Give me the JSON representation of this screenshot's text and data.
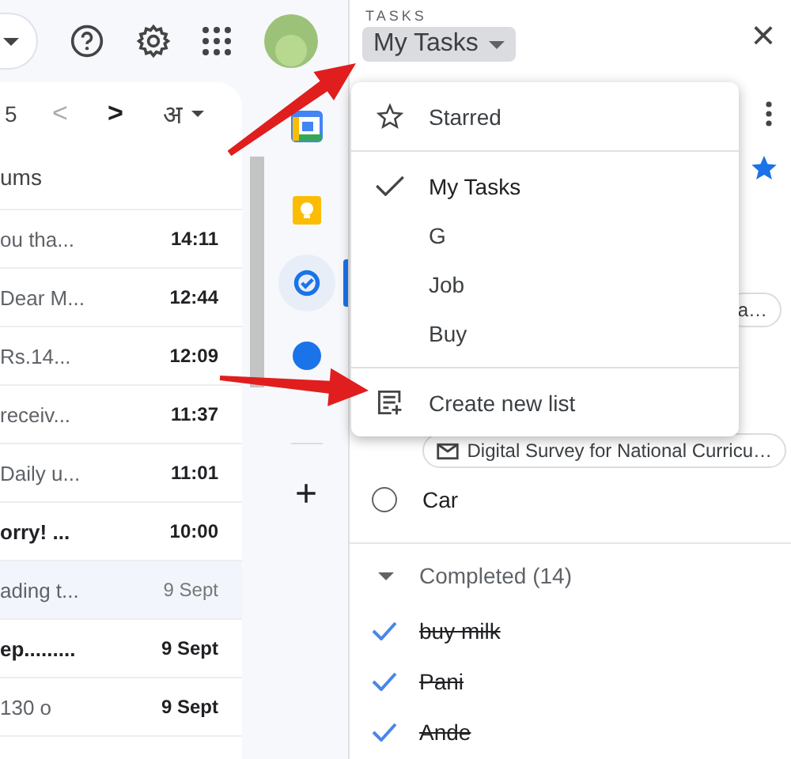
{
  "mail": {
    "pager": {
      "range": "5",
      "prev": "<",
      "next": ">",
      "language": "अ"
    },
    "heading": "ums",
    "rows": [
      {
        "text": "ou tha...",
        "time": "14:11",
        "kind": "snippet",
        "unread": true,
        "selected": false
      },
      {
        "text": "Dear M...",
        "time": "12:44",
        "kind": "snippet",
        "unread": true,
        "selected": false
      },
      {
        "text": "Rs.14...",
        "time": "12:09",
        "kind": "snippet",
        "unread": true,
        "selected": false
      },
      {
        "text": "receiv...",
        "time": "11:37",
        "kind": "snippet",
        "unread": true,
        "selected": false
      },
      {
        "text": "Daily u...",
        "time": "11:01",
        "kind": "snippet",
        "unread": true,
        "selected": false
      },
      {
        "text": "orry! ...",
        "time": "10:00",
        "kind": "subject",
        "unread": true,
        "selected": false
      },
      {
        "text": "ading t...",
        "time": "9 Sept",
        "kind": "snippet",
        "unread": false,
        "selected": true
      },
      {
        "text": "ep.........",
        "time": "9 Sept",
        "kind": "subject",
        "unread": true,
        "selected": false
      },
      {
        "text": "130 o",
        "time": "9 Sept",
        "kind": "snippet",
        "unread": true,
        "selected": false
      }
    ]
  },
  "rail": {
    "add": "+"
  },
  "tasks": {
    "label": "TASKS",
    "list_name": "My Tasks",
    "close": "×",
    "menu": [
      {
        "kind": "starred",
        "label": "Starred",
        "selected": false
      },
      {
        "kind": "list",
        "label": "My Tasks",
        "selected": true
      },
      {
        "kind": "list",
        "label": "G",
        "selected": false
      },
      {
        "kind": "list",
        "label": "Job",
        "selected": false
      },
      {
        "kind": "list",
        "label": "Buy",
        "selected": false
      },
      {
        "kind": "create",
        "label": "Create new list",
        "selected": false
      }
    ],
    "chip_top": "a…",
    "chip_mail": "Digital Survey for National Curricu…",
    "open_tasks": [
      {
        "title": "Car",
        "done": false
      }
    ],
    "completed": {
      "label": "Completed (14)",
      "expanded": true,
      "items": [
        {
          "title": "buy milk",
          "done": true
        },
        {
          "title": "Pani",
          "done": true
        },
        {
          "title": "Ande",
          "done": true
        }
      ]
    }
  }
}
